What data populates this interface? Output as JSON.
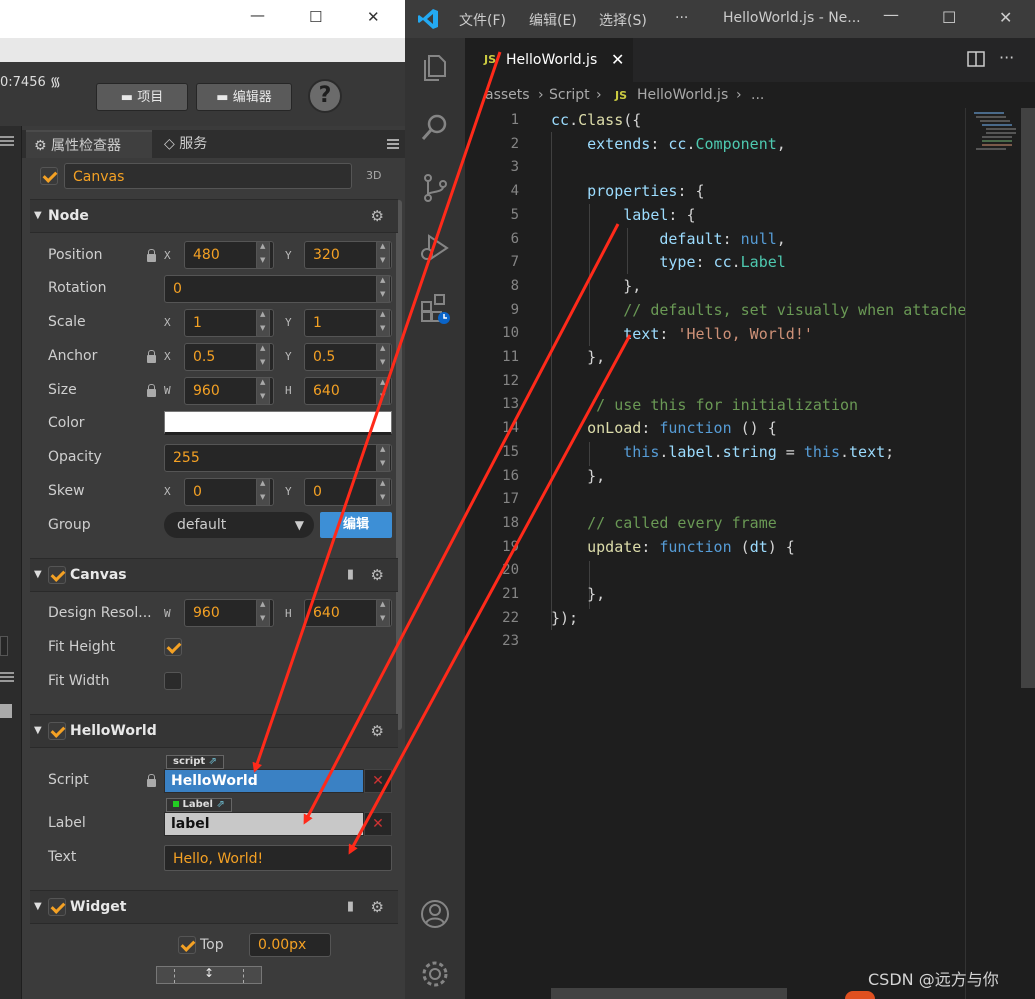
{
  "cocos": {
    "ip_fragment": "0:7456",
    "toolbar": {
      "project_label": "项目",
      "editor_label": "编辑器",
      "help_label": "?"
    },
    "tabs": {
      "inspector": "属性检查器",
      "service": "服务"
    },
    "node_name": "Canvas",
    "badge_3d": "3D",
    "node_section": {
      "title": "Node",
      "position": {
        "label": "Position",
        "x": "480",
        "y": "320"
      },
      "rotation": {
        "label": "Rotation",
        "value": "0"
      },
      "scale": {
        "label": "Scale",
        "x": "1",
        "y": "1"
      },
      "anchor": {
        "label": "Anchor",
        "x": "0.5",
        "y": "0.5"
      },
      "size": {
        "label": "Size",
        "w": "960",
        "h": "640"
      },
      "color": {
        "label": "Color",
        "value": "#ffffff"
      },
      "opacity": {
        "label": "Opacity",
        "value": "255"
      },
      "skew": {
        "label": "Skew",
        "x": "0",
        "y": "0"
      },
      "group": {
        "label": "Group",
        "value": "default",
        "edit_label": "编辑"
      }
    },
    "canvas_section": {
      "title": "Canvas",
      "design_resolution": {
        "label": "Design Resol...",
        "w": "960",
        "h": "640"
      },
      "fit_height": {
        "label": "Fit Height",
        "checked": true
      },
      "fit_width": {
        "label": "Fit Width",
        "checked": false
      }
    },
    "helloworld_section": {
      "title": "HelloWorld",
      "script": {
        "label": "Script",
        "tag": "script",
        "value": "HelloWorld"
      },
      "label": {
        "label": "Label",
        "tag": "Label",
        "value": "label"
      },
      "text": {
        "label": "Text",
        "value": "Hello, World!"
      }
    },
    "widget_section": {
      "title": "Widget",
      "top": {
        "label": "Top",
        "value": "0.00px"
      }
    },
    "axes": {
      "x": "X",
      "y": "Y",
      "w": "W",
      "h": "H"
    }
  },
  "vscode": {
    "menu": [
      "文件(F)",
      "编辑(E)",
      "选择(S)",
      "···"
    ],
    "window_title": "HelloWorld.js - Ne...",
    "tab": {
      "badge": "JS",
      "name": "HelloWorld.js"
    },
    "breadcrumb": {
      "part1": "assets",
      "part2": "Script",
      "badge": "JS",
      "file": "HelloWorld.js",
      "more": "..."
    },
    "line_numbers": [
      "1",
      "2",
      "3",
      "4",
      "5",
      "6",
      "7",
      "8",
      "9",
      "10",
      "11",
      "12",
      "13",
      "14",
      "15",
      "16",
      "17",
      "18",
      "19",
      "20",
      "21",
      "22",
      "23"
    ]
  },
  "watermark": "CSDN @远方与你",
  "colors": {
    "accent_orange": "#f4a124",
    "arrow_red": "#ff2a1a",
    "vscode_blue": "#007acc"
  }
}
